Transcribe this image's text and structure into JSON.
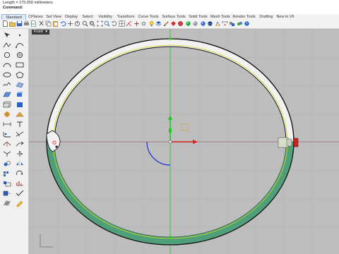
{
  "command_area": {
    "history_line": "Length = 175.050 millimeters",
    "prompt": "Command:"
  },
  "tabs": [
    {
      "label": "Standard"
    },
    {
      "label": "CPlanes"
    },
    {
      "label": "Set View"
    },
    {
      "label": "Display"
    },
    {
      "label": "Select"
    },
    {
      "label": "Visibility"
    },
    {
      "label": "Transform"
    },
    {
      "label": "Curve Tools"
    },
    {
      "label": "Surface Tools"
    },
    {
      "label": "Solid Tools"
    },
    {
      "label": "Mesh Tools"
    },
    {
      "label": "Render Tools"
    },
    {
      "label": "Drafting"
    },
    {
      "label": "New in V6"
    }
  ],
  "viewport": {
    "label": "Front",
    "menu_glyph": "▾"
  },
  "colors": {
    "viewport_bg": "#bdbdbd",
    "grid_minor": "#c6c6c6",
    "grid_major": "#a9a9a9",
    "x_axis": "#e11d1d",
    "y_axis": "#27c427",
    "shell_top": "#f2f2f2",
    "shell_bottom": "#4fa07a",
    "outline": "#111111",
    "seam": "#d8d81a"
  }
}
